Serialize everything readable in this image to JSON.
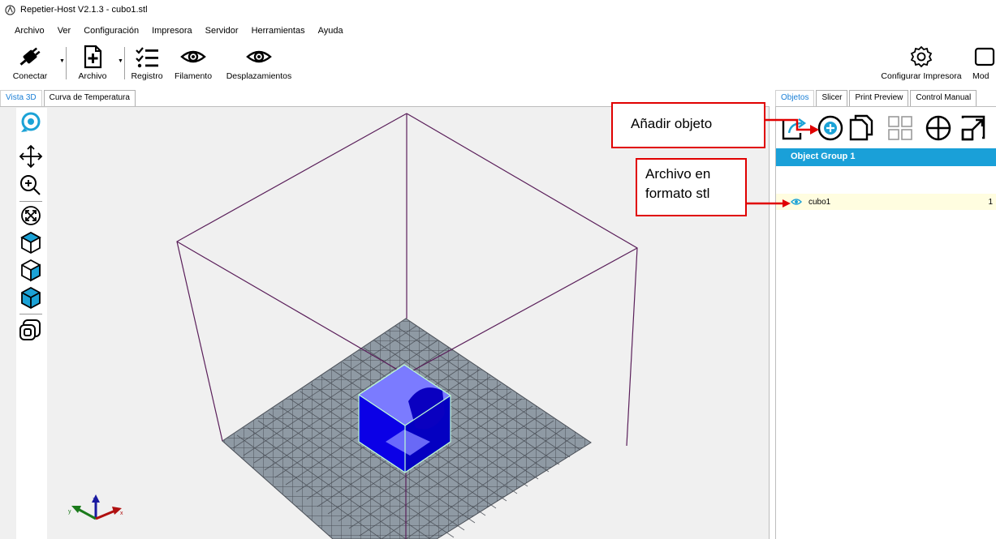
{
  "window": {
    "title": "Repetier-Host V2.1.3 - cubo1.stl"
  },
  "menu": [
    "Archivo",
    "Ver",
    "Configuración",
    "Impresora",
    "Servidor",
    "Herramientas",
    "Ayuda"
  ],
  "toolbar": {
    "connect": "Conectar",
    "file": "Archivo",
    "log": "Registro",
    "filament": "Filamento",
    "moves": "Desplazamientos",
    "printer_config": "Configurar Impresora",
    "mode_cut": "Mod"
  },
  "view_tabs": [
    "Vista 3D",
    "Curva de Temperatura"
  ],
  "panel_tabs": [
    "Objetos",
    "Slicer",
    "Print Preview",
    "Control Manual"
  ],
  "object_list": {
    "group": "Object Group 1",
    "items": [
      {
        "name": "cubo1",
        "value": "1"
      }
    ]
  },
  "annotations": {
    "add_object": "Añadir objeto",
    "stl_file_line1": "Archivo en",
    "stl_file_line2": "formato stl"
  },
  "colors": {
    "accent": "#1aa0d8",
    "icon": "#1ba2d6",
    "cube": "#0b00e6",
    "callout": "#e00000",
    "frame": "#5a1f5a"
  }
}
